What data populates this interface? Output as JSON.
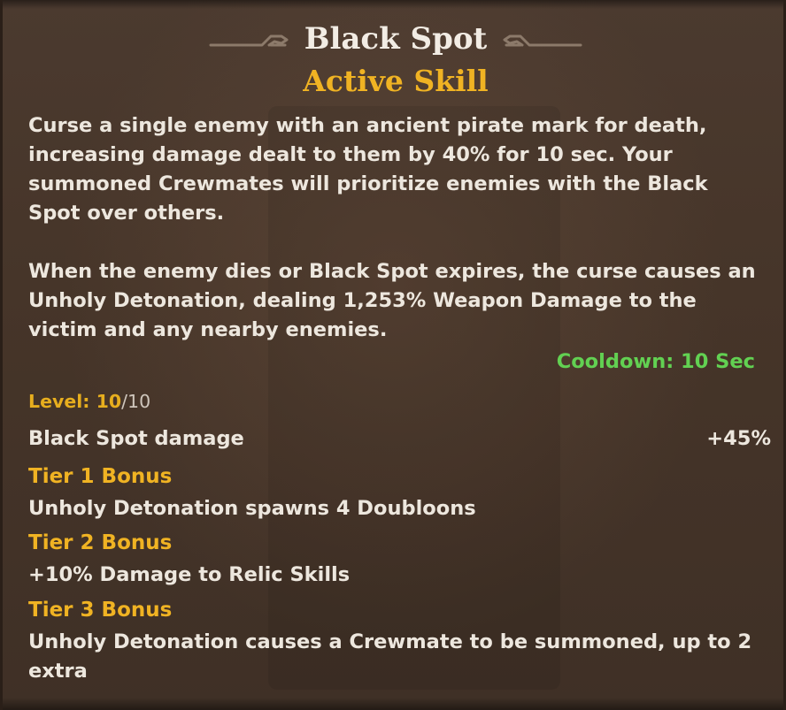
{
  "skill": {
    "name": "Black Spot",
    "type": "Active Skill",
    "description_1": "Curse a single enemy with an ancient pirate mark for death, increasing damage dealt to them by 40% for 10 sec. Your summoned Crewmates will prioritize enemies with the Black Spot over others.",
    "description_2": "When the enemy dies or Black Spot expires, the curse causes an Unholy Detonation, dealing 1,253% Weapon Damage to the victim and any nearby enemies.",
    "cooldown": "Cooldown: 10 Sec"
  },
  "level": {
    "label": "Level: 10",
    "max": "/10"
  },
  "stats": [
    {
      "name": "Black Spot damage",
      "value": "+45%"
    }
  ],
  "tiers": [
    {
      "title": "Tier 1 Bonus",
      "text": "Unholy Detonation spawns 4 Doubloons"
    },
    {
      "title": "Tier 2 Bonus",
      "text": "+10% Damage to Relic Skills"
    },
    {
      "title": "Tier 3 Bonus",
      "text": "Unholy Detonation causes a Crewmate to be summoned, up to 2 extra"
    }
  ],
  "colors": {
    "title": "#f2ece4",
    "accent_gold": "#f0b323",
    "cooldown_green": "#62d152",
    "body_text": "#ede7de",
    "panel_bg": "#463529"
  },
  "icons": {
    "left_ornament": "scroll-ornament-left-icon",
    "right_ornament": "scroll-ornament-right-icon"
  }
}
